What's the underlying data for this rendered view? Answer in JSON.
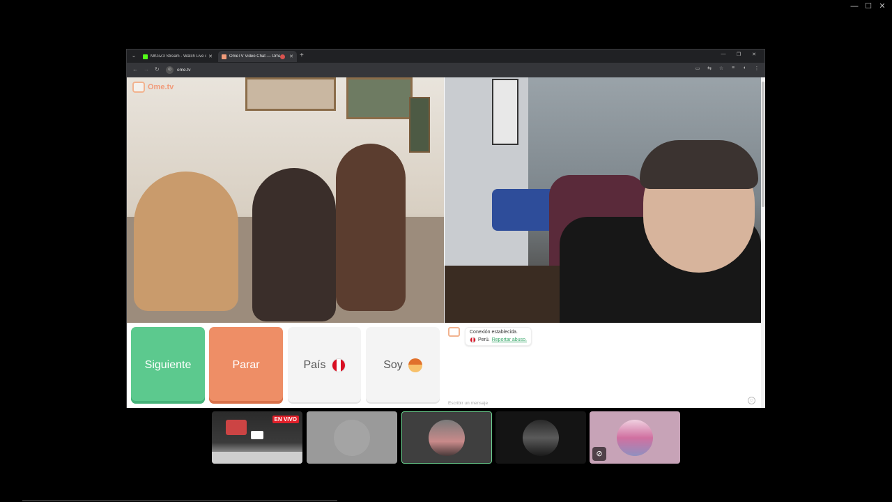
{
  "browser": {
    "tabs": [
      {
        "title": "MKGZ3 Stream - Watch Live on",
        "favicon_color": "#53fc18",
        "active": false
      },
      {
        "title": "OmeTV Video Chat — Ome",
        "favicon_color": "#f19b7a",
        "active": true
      }
    ],
    "url": "ome.tv"
  },
  "site": {
    "logo_text": "Ome.tv"
  },
  "buttons": {
    "next_label": "Siguiente",
    "stop_label": "Parar",
    "country_label": "País",
    "me_label": "Soy"
  },
  "chat": {
    "status": "Conexión establecida.",
    "country": "Perú.",
    "report_link": "Reportar abuso.",
    "input_placeholder": "Escribir un mensaje"
  },
  "stream_overlay": {
    "live_badge": "EN VIVO"
  },
  "colors": {
    "next": "#5cc98e",
    "stop": "#ee8e66",
    "accent": "#f19b7a",
    "live": "#e0202a"
  }
}
